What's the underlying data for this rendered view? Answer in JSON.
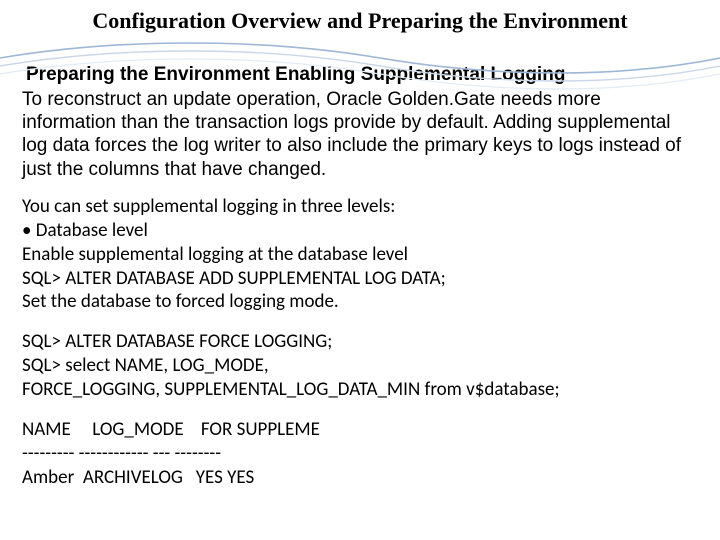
{
  "title": "Configuration Overview and Preparing the Environment",
  "subtitle": "Preparing the Environment Enabling Supplemental Logging",
  "intro": "To reconstruct an update operation, Oracle Golden.Gate needs more information than the transaction logs provide by default. Adding supplemental log data forces the log writer to also include the primary keys to logs instead of just the columns that have changed.",
  "block1": {
    "l1": "You can set supplemental logging in three levels:",
    "l2": "• Database level",
    "l3": "Enable supplemental logging at the database level",
    "l4": "SQL> ALTER DATABASE ADD SUPPLEMENTAL LOG DATA;",
    "l5": "Set the database to forced logging mode."
  },
  "block2": {
    "l1": "SQL> ALTER DATABASE FORCE LOGGING;",
    "l2": "SQL> select NAME, LOG_MODE,",
    "l3": "FORCE_LOGGING, SUPPLEMENTAL_LOG_DATA_MIN from v$database;"
  },
  "block3": {
    "l1": "NAME     LOG_MODE    FOR SUPPLEME",
    "l2": "--------- ------------ --- --------",
    "l3": "Amber  ARCHIVELOG   YES YES"
  }
}
